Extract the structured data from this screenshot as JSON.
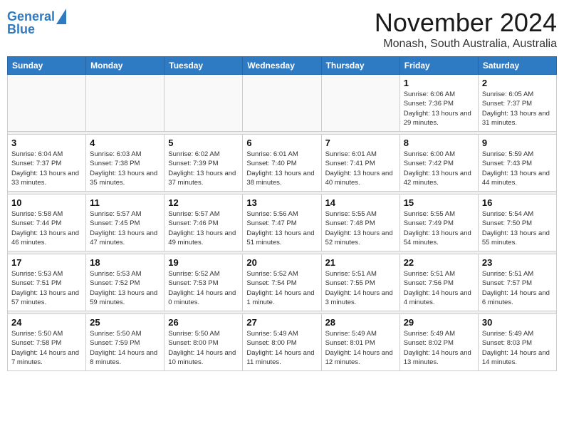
{
  "header": {
    "logo_line1": "General",
    "logo_line2": "Blue",
    "month": "November 2024",
    "location": "Monash, South Australia, Australia"
  },
  "days_of_week": [
    "Sunday",
    "Monday",
    "Tuesday",
    "Wednesday",
    "Thursday",
    "Friday",
    "Saturday"
  ],
  "weeks": [
    [
      {
        "date": "",
        "info": ""
      },
      {
        "date": "",
        "info": ""
      },
      {
        "date": "",
        "info": ""
      },
      {
        "date": "",
        "info": ""
      },
      {
        "date": "",
        "info": ""
      },
      {
        "date": "1",
        "info": "Sunrise: 6:06 AM\nSunset: 7:36 PM\nDaylight: 13 hours and 29 minutes."
      },
      {
        "date": "2",
        "info": "Sunrise: 6:05 AM\nSunset: 7:37 PM\nDaylight: 13 hours and 31 minutes."
      }
    ],
    [
      {
        "date": "3",
        "info": "Sunrise: 6:04 AM\nSunset: 7:37 PM\nDaylight: 13 hours and 33 minutes."
      },
      {
        "date": "4",
        "info": "Sunrise: 6:03 AM\nSunset: 7:38 PM\nDaylight: 13 hours and 35 minutes."
      },
      {
        "date": "5",
        "info": "Sunrise: 6:02 AM\nSunset: 7:39 PM\nDaylight: 13 hours and 37 minutes."
      },
      {
        "date": "6",
        "info": "Sunrise: 6:01 AM\nSunset: 7:40 PM\nDaylight: 13 hours and 38 minutes."
      },
      {
        "date": "7",
        "info": "Sunrise: 6:01 AM\nSunset: 7:41 PM\nDaylight: 13 hours and 40 minutes."
      },
      {
        "date": "8",
        "info": "Sunrise: 6:00 AM\nSunset: 7:42 PM\nDaylight: 13 hours and 42 minutes."
      },
      {
        "date": "9",
        "info": "Sunrise: 5:59 AM\nSunset: 7:43 PM\nDaylight: 13 hours and 44 minutes."
      }
    ],
    [
      {
        "date": "10",
        "info": "Sunrise: 5:58 AM\nSunset: 7:44 PM\nDaylight: 13 hours and 46 minutes."
      },
      {
        "date": "11",
        "info": "Sunrise: 5:57 AM\nSunset: 7:45 PM\nDaylight: 13 hours and 47 minutes."
      },
      {
        "date": "12",
        "info": "Sunrise: 5:57 AM\nSunset: 7:46 PM\nDaylight: 13 hours and 49 minutes."
      },
      {
        "date": "13",
        "info": "Sunrise: 5:56 AM\nSunset: 7:47 PM\nDaylight: 13 hours and 51 minutes."
      },
      {
        "date": "14",
        "info": "Sunrise: 5:55 AM\nSunset: 7:48 PM\nDaylight: 13 hours and 52 minutes."
      },
      {
        "date": "15",
        "info": "Sunrise: 5:55 AM\nSunset: 7:49 PM\nDaylight: 13 hours and 54 minutes."
      },
      {
        "date": "16",
        "info": "Sunrise: 5:54 AM\nSunset: 7:50 PM\nDaylight: 13 hours and 55 minutes."
      }
    ],
    [
      {
        "date": "17",
        "info": "Sunrise: 5:53 AM\nSunset: 7:51 PM\nDaylight: 13 hours and 57 minutes."
      },
      {
        "date": "18",
        "info": "Sunrise: 5:53 AM\nSunset: 7:52 PM\nDaylight: 13 hours and 59 minutes."
      },
      {
        "date": "19",
        "info": "Sunrise: 5:52 AM\nSunset: 7:53 PM\nDaylight: 14 hours and 0 minutes."
      },
      {
        "date": "20",
        "info": "Sunrise: 5:52 AM\nSunset: 7:54 PM\nDaylight: 14 hours and 1 minute."
      },
      {
        "date": "21",
        "info": "Sunrise: 5:51 AM\nSunset: 7:55 PM\nDaylight: 14 hours and 3 minutes."
      },
      {
        "date": "22",
        "info": "Sunrise: 5:51 AM\nSunset: 7:56 PM\nDaylight: 14 hours and 4 minutes."
      },
      {
        "date": "23",
        "info": "Sunrise: 5:51 AM\nSunset: 7:57 PM\nDaylight: 14 hours and 6 minutes."
      }
    ],
    [
      {
        "date": "24",
        "info": "Sunrise: 5:50 AM\nSunset: 7:58 PM\nDaylight: 14 hours and 7 minutes."
      },
      {
        "date": "25",
        "info": "Sunrise: 5:50 AM\nSunset: 7:59 PM\nDaylight: 14 hours and 8 minutes."
      },
      {
        "date": "26",
        "info": "Sunrise: 5:50 AM\nSunset: 8:00 PM\nDaylight: 14 hours and 10 minutes."
      },
      {
        "date": "27",
        "info": "Sunrise: 5:49 AM\nSunset: 8:00 PM\nDaylight: 14 hours and 11 minutes."
      },
      {
        "date": "28",
        "info": "Sunrise: 5:49 AM\nSunset: 8:01 PM\nDaylight: 14 hours and 12 minutes."
      },
      {
        "date": "29",
        "info": "Sunrise: 5:49 AM\nSunset: 8:02 PM\nDaylight: 14 hours and 13 minutes."
      },
      {
        "date": "30",
        "info": "Sunrise: 5:49 AM\nSunset: 8:03 PM\nDaylight: 14 hours and 14 minutes."
      }
    ]
  ]
}
